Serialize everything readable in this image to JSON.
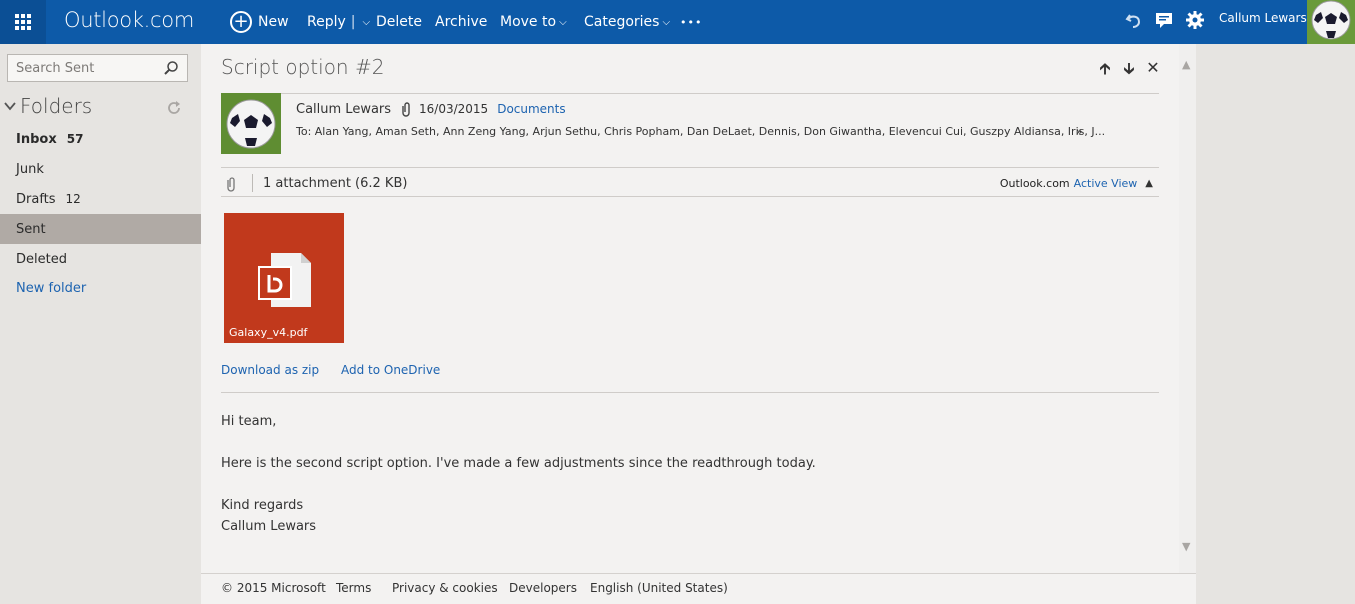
{
  "topbar": {
    "brand": "Outlook.com",
    "commands": {
      "new": "New",
      "reply": "Reply",
      "delete": "Delete",
      "archive": "Archive",
      "move_to": "Move to",
      "categories": "Categories",
      "more": "•••"
    },
    "user_name": "Callum Lewars",
    "colors": {
      "bar": "#0d5aa8",
      "waffle": "#0b4f95"
    }
  },
  "sidebar": {
    "search_placeholder": "Search Sent",
    "folders_heading": "Folders",
    "folders": [
      {
        "label": "Inbox",
        "count": "57",
        "bold": true
      },
      {
        "label": "Junk",
        "count": ""
      },
      {
        "label": "Drafts",
        "count": "12"
      },
      {
        "label": "Sent",
        "count": "",
        "selected": true
      },
      {
        "label": "Deleted",
        "count": ""
      },
      {
        "label": "New folder",
        "count": ""
      }
    ]
  },
  "message": {
    "subject": "Script option #2",
    "sender": "Callum Lewars",
    "date": "16/03/2015",
    "folder_link": "Documents",
    "to": "To: Alan Yang, Aman Seth, Ann Zeng Yang, Arjun Sethu, Chris Popham, Dan DeLaet, Dennis, Don Giwantha, Elevencui Cui, Guszpy Aldiansa, Iris, J...",
    "expand_glyph": "»",
    "attachment_summary": "1 attachment (6.2 KB)",
    "active_view_brand": "Outlook.com",
    "active_view_link": "Active View",
    "attachment_name": "Galaxy_v4.pdf",
    "attachment_color": "#c1391c",
    "download_zip": "Download as zip",
    "add_onedrive": "Add to OneDrive",
    "body": {
      "greeting": "Hi team,",
      "line1": "Here is the second script option. I've made a few adjustments since the readthrough today.",
      "closing": "Kind regards",
      "signature": "Callum Lewars"
    }
  },
  "footer": {
    "copyright": "© 2015 Microsoft",
    "terms": "Terms",
    "privacy": "Privacy & cookies",
    "developers": "Developers",
    "language": "English (United States)"
  }
}
